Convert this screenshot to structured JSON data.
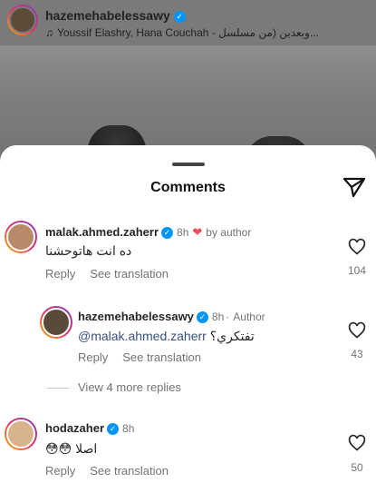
{
  "post_header": {
    "username": "hazemehabelessawy",
    "music": "Youssif Elashry, Hana Couchah",
    "music_subtitle": "وبعدين (من مسلسل..."
  },
  "sheet": {
    "title": "Comments"
  },
  "comments": [
    {
      "username": "malak.ahmed.zaherr",
      "time": "8h",
      "by_author": "by author",
      "text": "ده انت هاتوحشنا",
      "reply": "Reply",
      "see_translation": "See translation",
      "likes": "104"
    },
    {
      "username": "hazemehabelessawy",
      "time": "8h",
      "author_tag": "Author",
      "mention": "@malak.ahmed.zaherr",
      "text": "تفتكري؟",
      "reply": "Reply",
      "see_translation": "See translation",
      "likes": "43"
    },
    {
      "view_more": "View 4 more replies"
    },
    {
      "username": "hodazaher",
      "time": "8h",
      "text": "اصلا",
      "emoji": "😳😳",
      "reply": "Reply",
      "see_translation": "See translation",
      "likes": "50"
    }
  ],
  "colors": {
    "verified": "#0095f6",
    "heart": "#ed4956",
    "mention": "#385185"
  }
}
